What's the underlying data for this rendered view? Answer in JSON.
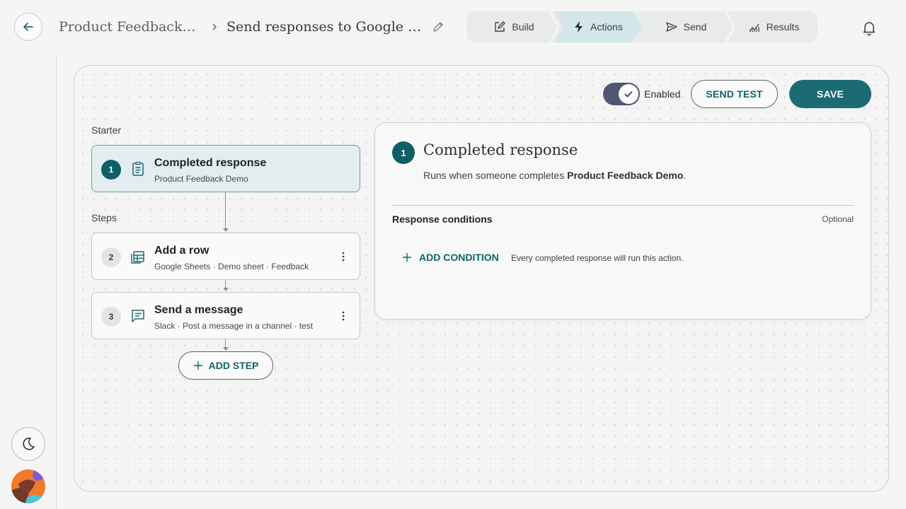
{
  "header": {
    "breadcrumb_parent": "Product Feedback Demo",
    "breadcrumb_current": "Send responses to Google Sheets",
    "tabs": [
      {
        "label": "Build",
        "icon": "edit-icon"
      },
      {
        "label": "Actions",
        "icon": "bolt-icon",
        "active": true
      },
      {
        "label": "Send",
        "icon": "send-icon"
      },
      {
        "label": "Results",
        "icon": "chart-icon"
      }
    ]
  },
  "toolbar": {
    "toggle_label": "Enabled",
    "enabled": true,
    "send_test_label": "SEND TEST",
    "save_label": "SAVE"
  },
  "flow": {
    "starter_label": "Starter",
    "steps_label": "Steps",
    "starter": {
      "number": "1",
      "title": "Completed response",
      "subtitle": "Product Feedback Demo",
      "icon": "clipboard-icon"
    },
    "steps": [
      {
        "number": "2",
        "title": "Add a row",
        "subtitle": "Google Sheets · Demo sheet · Feedback",
        "icon": "table-icon"
      },
      {
        "number": "3",
        "title": "Send a message",
        "subtitle": "Slack · Post a message in a channel · test",
        "icon": "message-icon"
      }
    ],
    "add_step_label": "ADD STEP"
  },
  "detail": {
    "number": "1",
    "title": "Completed response",
    "desc_prefix": "Runs when someone completes ",
    "desc_bold": "Product Feedback Demo",
    "desc_suffix": ".",
    "conditions_label": "Response conditions",
    "optional_label": "Optional",
    "add_condition_label": "ADD CONDITION",
    "condition_note": "Every completed response will run this action."
  },
  "colors": {
    "accent": "#1c6b74",
    "active_tab": "#d3e6ea",
    "toggle": "#4e5870"
  }
}
